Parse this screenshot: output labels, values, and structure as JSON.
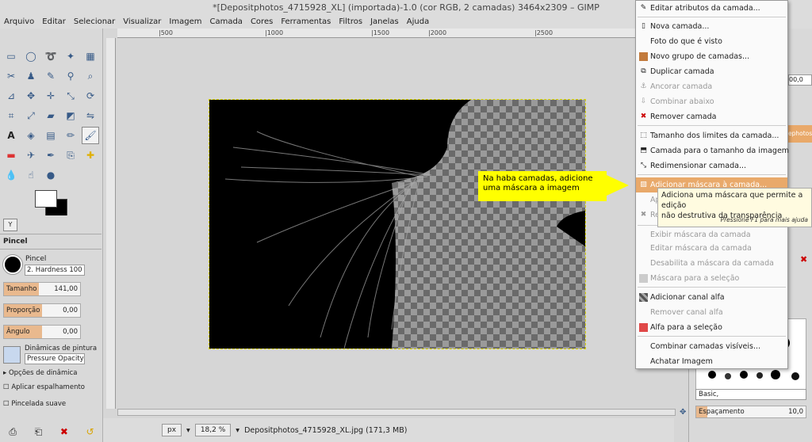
{
  "window": {
    "title": "*[Depositphotos_4715928_XL] (importada)-1.0 (cor RGB, 2 camadas) 3464x2309 – GIMP"
  },
  "menubar": [
    "Arquivo",
    "Editar",
    "Selecionar",
    "Visualizar",
    "Imagem",
    "Camada",
    "Cores",
    "Ferramentas",
    "Filtros",
    "Janelas",
    "Ajuda"
  ],
  "ruler": {
    "ticks": [
      "500",
      "1000",
      "1500",
      "2000",
      "2500"
    ],
    "labels": [
      "|500",
      "|1000",
      "|1500",
      "|2000",
      "|2500"
    ]
  },
  "tool_options": {
    "title": "Pincel",
    "brush_label": "Pincel",
    "brush_name": "2. Hardness 100",
    "size": {
      "label": "Tamanho",
      "value": "141,00",
      "fraction": 0.46
    },
    "ratio": {
      "label": "Proporção",
      "value": "0,00",
      "fraction": 0.5
    },
    "angle": {
      "label": "Ângulo",
      "value": "0,00",
      "fraction": 0.5
    },
    "dynamics_label": "Dinâmicas de pintura",
    "dynamics_value": "Pressure Opacity",
    "dynamics_options": "Opções de dinâmica",
    "apply_jitter": "Aplicar espalhamento",
    "smooth_stroke": "Pincelada suave"
  },
  "status": {
    "unit": "px",
    "zoom": "18,2 %",
    "file": "Depositphotos_4715928_XL.jpg (171,3 MB)"
  },
  "callout": {
    "line1": "Na haba camadas, adicione",
    "line2": "uma máscara a imagem"
  },
  "menu": {
    "items": [
      {
        "label": "Editar atributos da camada...",
        "enabled": true
      },
      {
        "label": "Nova camada...",
        "enabled": true
      },
      {
        "label": "Foto do que é visto",
        "enabled": true
      },
      {
        "label": "Novo grupo de camadas...",
        "enabled": true
      },
      {
        "label": "Duplicar camada",
        "enabled": true
      },
      {
        "label": "Ancorar camada",
        "enabled": false
      },
      {
        "label": "Combinar abaixo",
        "enabled": false
      },
      {
        "label": "Remover camada",
        "enabled": true
      },
      {
        "label": "Tamanho dos limites da camada...",
        "enabled": true
      },
      {
        "label": "Camada para o tamanho da imagem",
        "enabled": true
      },
      {
        "label": "Redimensionar camada...",
        "enabled": true
      },
      {
        "label": "Adicionar máscara à camada...",
        "enabled": true,
        "highlighted": true
      },
      {
        "label": "Ap",
        "enabled": false
      },
      {
        "label": "Re",
        "enabled": false
      },
      {
        "label": "Exibir máscara da camada",
        "enabled": false
      },
      {
        "label": "Editar máscara da camada",
        "enabled": false
      },
      {
        "label": "Desabilita a máscara da camada",
        "enabled": false
      },
      {
        "label": "Máscara para a seleção",
        "enabled": false
      },
      {
        "label": "Adicionar canal alfa",
        "enabled": true
      },
      {
        "label": "Remover canal alfa",
        "enabled": false
      },
      {
        "label": "Alfa para a seleção",
        "enabled": true
      },
      {
        "label": "Combinar camadas visíveis...",
        "enabled": true
      },
      {
        "label": "Achatar Imagem",
        "enabled": true
      }
    ]
  },
  "tooltip": {
    "line1": "Adiciona uma máscara que permite a edição",
    "line2": "não destrutiva da transparência",
    "hint": "Pressione F1 para mais ajuda"
  },
  "right_panel": {
    "opacity": "00,0",
    "layer_name": "ephotos_",
    "brush_set": "Basic,",
    "spacing_label": "Espaçamento",
    "spacing_value": "10,0"
  }
}
